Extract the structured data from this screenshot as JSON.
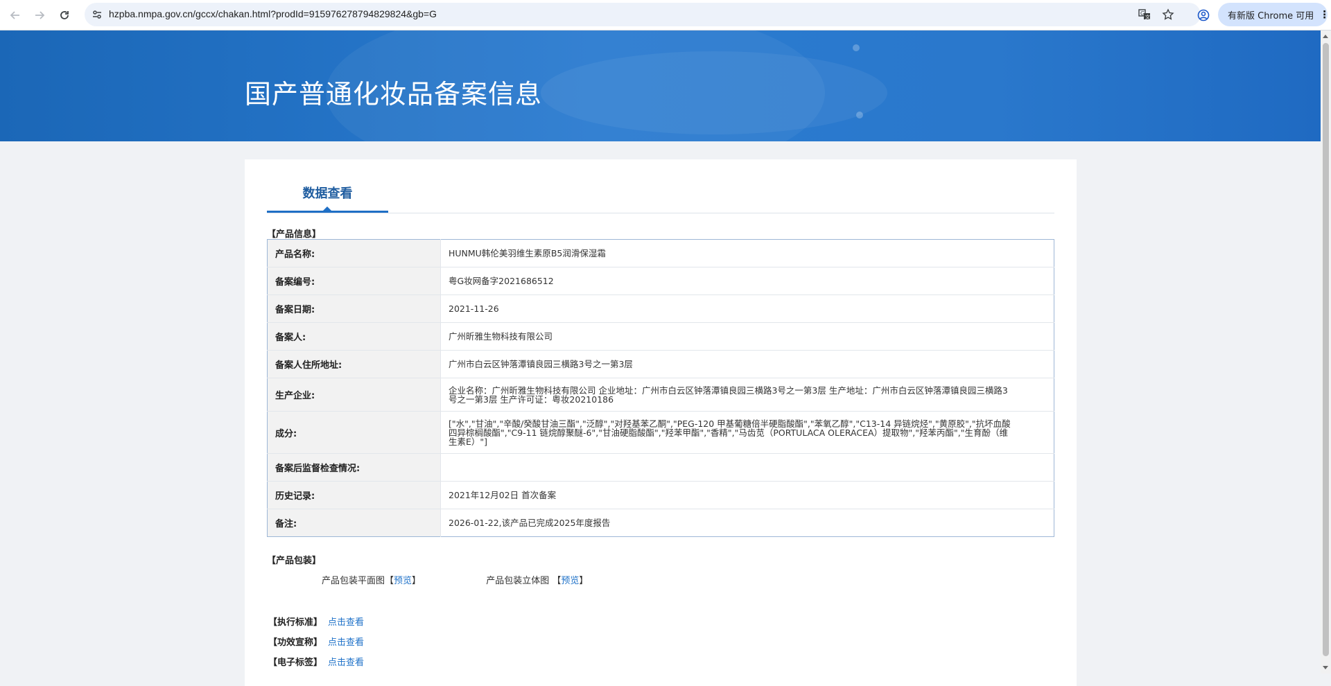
{
  "browser": {
    "url": "hzpba.nmpa.gov.cn/gccx/chakan.html?prodId=915976278794829824&gb=G",
    "update_label": "有新版 Chrome 可用"
  },
  "page": {
    "banner_title": "国产普通化妆品备案信息",
    "tab_label": "数据查看"
  },
  "product_info": {
    "section_title": "【产品信息】",
    "rows": [
      {
        "key": "产品名称:",
        "value": "HUNMU韩伦美羽维生素原B5润滑保湿霜"
      },
      {
        "key": "备案编号:",
        "value": "粤G妆网备字2021686512"
      },
      {
        "key": "备案日期:",
        "value": "2021-11-26"
      },
      {
        "key": "备案人:",
        "value": "广州昕雅生物科技有限公司"
      },
      {
        "key": "备案人住所地址:",
        "value": "广州市白云区钟落潭镇良园三横路3号之一第3层"
      },
      {
        "key": "生产企业:",
        "value": "企业名称：广州昕雅生物科技有限公司 企业地址：广州市白云区钟落潭镇良园三横路3号之一第3层 生产地址：广州市白云区钟落潭镇良园三横路3号之一第3层 生产许可证：粤妆20210186"
      },
      {
        "key": "成分:",
        "value": "[\"水\",\"甘油\",\"辛酸/癸酸甘油三酯\",\"泛醇\",\"对羟基苯乙酮\",\"PEG-120 甲基葡糖倍半硬脂酸酯\",\"苯氧乙醇\",\"C13-14 异链烷烃\",\"黄原胶\",\"抗坏血酸四异棕榈酸酯\",\"C9-11 链烷醇聚醚-6\",\"甘油硬脂酸酯\",\"羟苯甲酯\",\"香精\",\"马齿苋（PORTULACA OLERACEA）提取物\",\"羟苯丙酯\",\"生育酚（维生素E）\"]"
      },
      {
        "key": "备案后监督检查情况:",
        "value": ""
      },
      {
        "key": "历史记录:",
        "value": "2021年12月02日 首次备案"
      },
      {
        "key": "备注:",
        "value": "2026-01-22,该产品已完成2025年度报告"
      }
    ]
  },
  "packaging": {
    "section_title": "【产品包装】",
    "flat_label": "产品包装平面图",
    "solid_label": "产品包装立体图",
    "bracket_open": "【",
    "bracket_close": "】",
    "preview_link": "预览"
  },
  "bottom_links": [
    {
      "label": "【执行标准】",
      "link": "点击查看"
    },
    {
      "label": "【功效宣称】",
      "link": "点击查看"
    },
    {
      "label": "【电子标签】",
      "link": "点击查看"
    }
  ],
  "icons": {
    "back": "arrow-left-icon",
    "forward": "arrow-right-icon",
    "reload": "reload-icon",
    "site_info": "site-settings-icon",
    "translate": "translate-icon",
    "bookmark": "star-icon",
    "profile": "profile-icon",
    "menu": "more-vertical-icon"
  }
}
